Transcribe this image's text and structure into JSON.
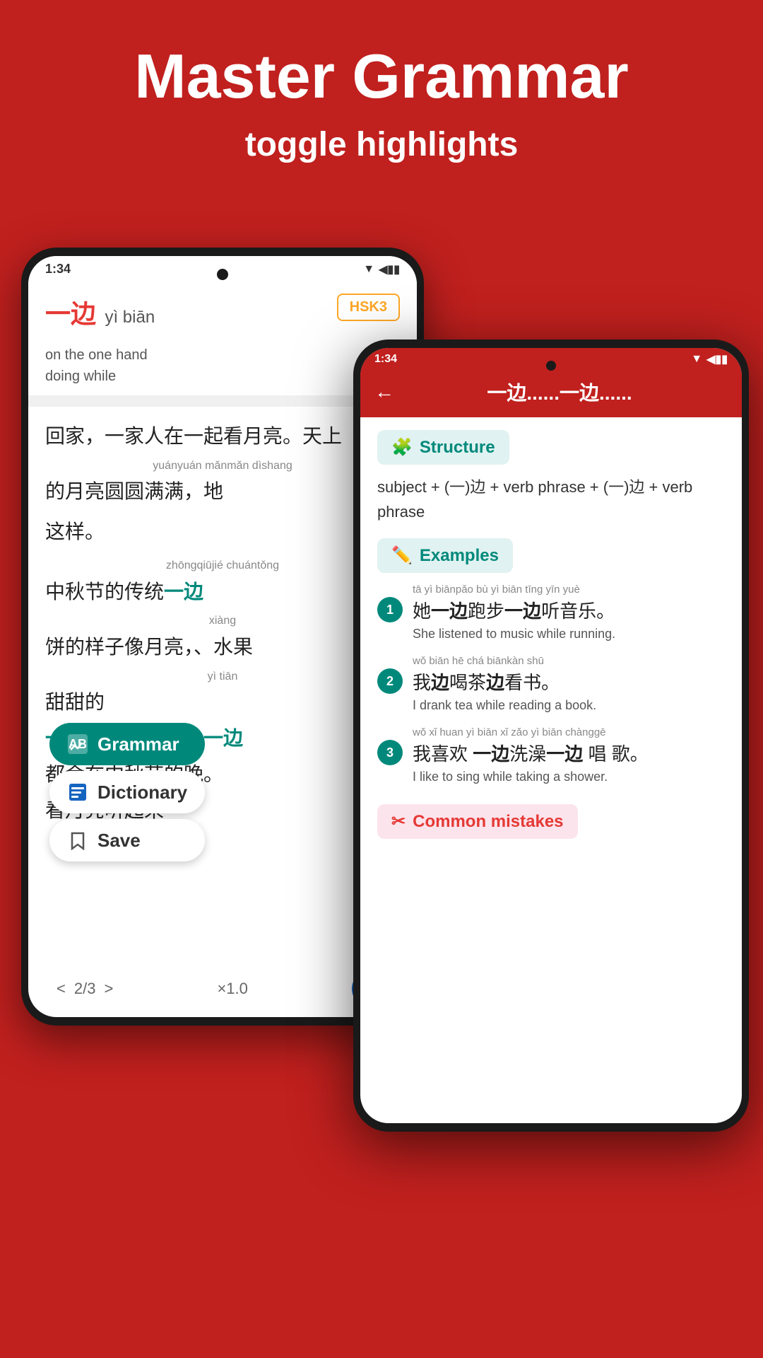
{
  "hero": {
    "title": "Master Grammar",
    "subtitle": "toggle highlights"
  },
  "back_phone": {
    "status": {
      "time": "1:34",
      "icons": "▼◀▮▮"
    },
    "word": {
      "chinese": "一边",
      "pinyin": "yì biān",
      "hsk": "HSK3",
      "meaning_line1": "on the one hand",
      "meaning_line2": "doing while"
    },
    "text_content": {
      "line1": "回家，一家人在一起看月亮。天上",
      "line2_pinyin": "yuányuán mǎnmǎn dìshang",
      "line2": "的月亮圆圆满满，地",
      "line3": "这样。",
      "line4_pinyin": "zhōngqiūjié chuántǒng",
      "line4": "中秋节的传统",
      "line5_pinyin": "xiàng",
      "line5": "饼的样子像月亮，",
      "line6": "、水果",
      "line7_pinyin": "yì tiān",
      "line7": "甜甜的",
      "line8": "一边吃月饼喝茶，",
      "line9": "都会在中秋节的晚。",
      "line10": "看月亮听起来"
    },
    "popup_menu": {
      "grammar_label": "Grammar",
      "dictionary_label": "Dictionary",
      "save_label": "Save"
    },
    "nav": {
      "prev": "<",
      "page": "2/3",
      "next": ">",
      "speed": "×1.0"
    }
  },
  "front_phone": {
    "status": {
      "time": "1:34",
      "icons": "▼◀▮▮"
    },
    "header": {
      "back_icon": "←",
      "title": "一边......一边......"
    },
    "structure": {
      "badge_icon": "🧩",
      "badge_label": "Structure",
      "text": "subject + (一)边 + verb phrase + (一)边 + verb phrase"
    },
    "examples": {
      "badge_icon": "✏️",
      "badge_label": "Examples",
      "items": [
        {
          "number": "1",
          "pinyin": "tā  yì biānpǎo bù  yì biān tīng yīn yuè",
          "chinese": "她一边跑步一边听音乐。",
          "english": "She listened to music while running."
        },
        {
          "number": "2",
          "pinyin": "wǒ biān hē chá biānkàn shū",
          "chinese": "我边喝茶边看书。",
          "english": "I drank tea while reading a book."
        },
        {
          "number": "3",
          "pinyin": "wǒ xǐ huan yì biān xǐ zǎo yì biān chànggē",
          "chinese": "我喜欢 一边洗澡一边 唱 歌。",
          "english": "I like to sing while taking a shower."
        }
      ]
    },
    "mistakes": {
      "badge_icon": "✂",
      "badge_label": "Common mistakes"
    }
  }
}
